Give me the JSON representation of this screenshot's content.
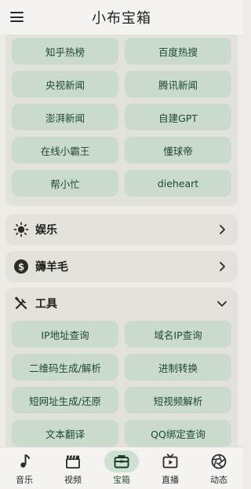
{
  "app": {
    "title": "小布宝箱"
  },
  "hot_section": {
    "items": [
      "知乎热榜",
      "百度热搜",
      "央视新闻",
      "腾讯新闻",
      "澎湃新闻",
      "自建GPT",
      "在线小霸王",
      "懂球帝",
      "帮小忙",
      "dieheart"
    ]
  },
  "sections": [
    {
      "label": "娱乐",
      "icon": "sun-icon",
      "state": "collapsed"
    },
    {
      "label": "薅羊毛",
      "icon": "dollar-coin-icon",
      "state": "collapsed"
    },
    {
      "label": "工具",
      "icon": "tools-icon",
      "state": "expanded"
    }
  ],
  "tools_section": {
    "items": [
      "IP地址查询",
      "域名IP查询",
      "二维码生成/解析",
      "进制转换",
      "短网址生成/还原",
      "短视频解析",
      "文本翻译",
      "QQ绑定查询"
    ]
  },
  "bottom_nav": {
    "active": "宝箱",
    "items": [
      {
        "label": "音乐",
        "icon": "music-note-icon"
      },
      {
        "label": "视频",
        "icon": "clapperboard-icon"
      },
      {
        "label": "宝箱",
        "icon": "toolbox-icon"
      },
      {
        "label": "直播",
        "icon": "tv-icon"
      },
      {
        "label": "动态",
        "icon": "aperture-icon"
      }
    ]
  },
  "colors": {
    "chip_bg": "#cadacd",
    "chip_text": "#1c4a2c",
    "card_bg": "#e2e1dc",
    "page_bg": "#ecebe7",
    "active_pill": "#cde0d1"
  }
}
